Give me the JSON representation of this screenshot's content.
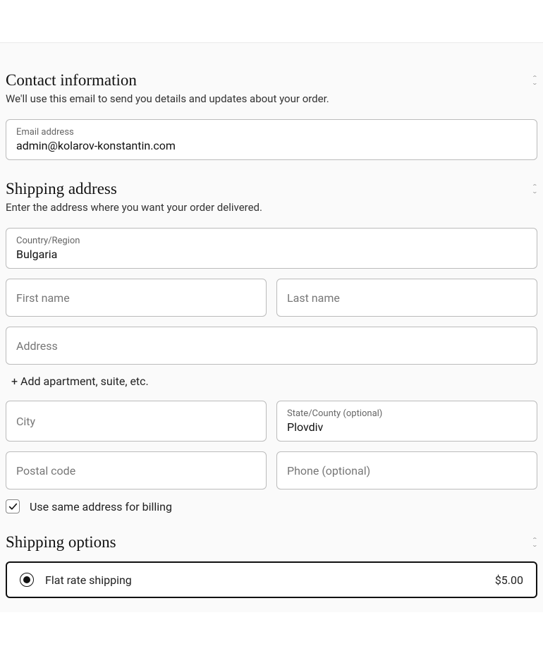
{
  "contact": {
    "title": "Contact information",
    "subtitle": "We'll use this email to send you details and updates about your order.",
    "email_label": "Email address",
    "email_value": "admin@kolarov-konstantin.com"
  },
  "shipping": {
    "title": "Shipping address",
    "subtitle": "Enter the address where you want your order delivered.",
    "country_label": "Country/Region",
    "country_value": "Bulgaria",
    "first_name_placeholder": "First name",
    "last_name_placeholder": "Last name",
    "address_placeholder": "Address",
    "add_apartment": "+ Add apartment, suite, etc.",
    "city_placeholder": "City",
    "state_label": "State/County (optional)",
    "state_value": "Plovdiv",
    "postal_placeholder": "Postal code",
    "phone_placeholder": "Phone (optional)",
    "billing_checkbox_label": "Use same address for billing",
    "billing_checked": true
  },
  "options": {
    "title": "Shipping options",
    "flat_rate_label": "Flat rate shipping",
    "flat_rate_price": "$5.00"
  }
}
